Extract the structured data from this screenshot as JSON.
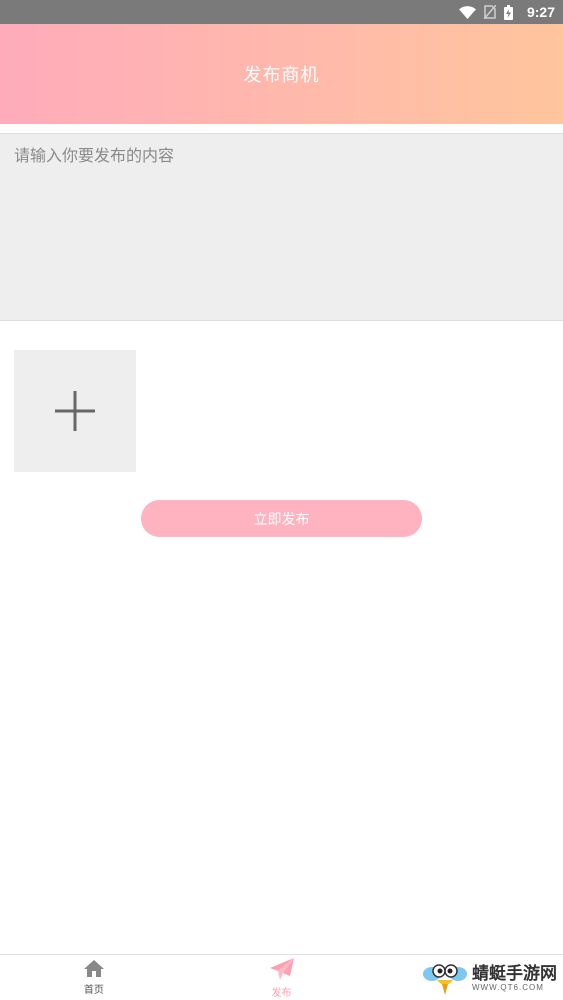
{
  "status_bar": {
    "time": "9:27"
  },
  "header": {
    "title": "发布商机"
  },
  "content": {
    "placeholder": "请输入你要发布的内容",
    "value": ""
  },
  "publish": {
    "label": "立即发布"
  },
  "bottom_nav": {
    "items": [
      {
        "label": "首页",
        "icon": "home-icon"
      },
      {
        "label": "发布",
        "icon": "paper-plane-icon",
        "active": true
      }
    ]
  },
  "watermark": {
    "brand": "蜻蜓手游网",
    "url": "WWW.QT6.COM"
  },
  "colors": {
    "header_gradient_start": "#ffabbb",
    "header_gradient_end": "#ffc59d",
    "accent_pink": "#ffb3c1",
    "input_bg": "#eeeeee"
  }
}
